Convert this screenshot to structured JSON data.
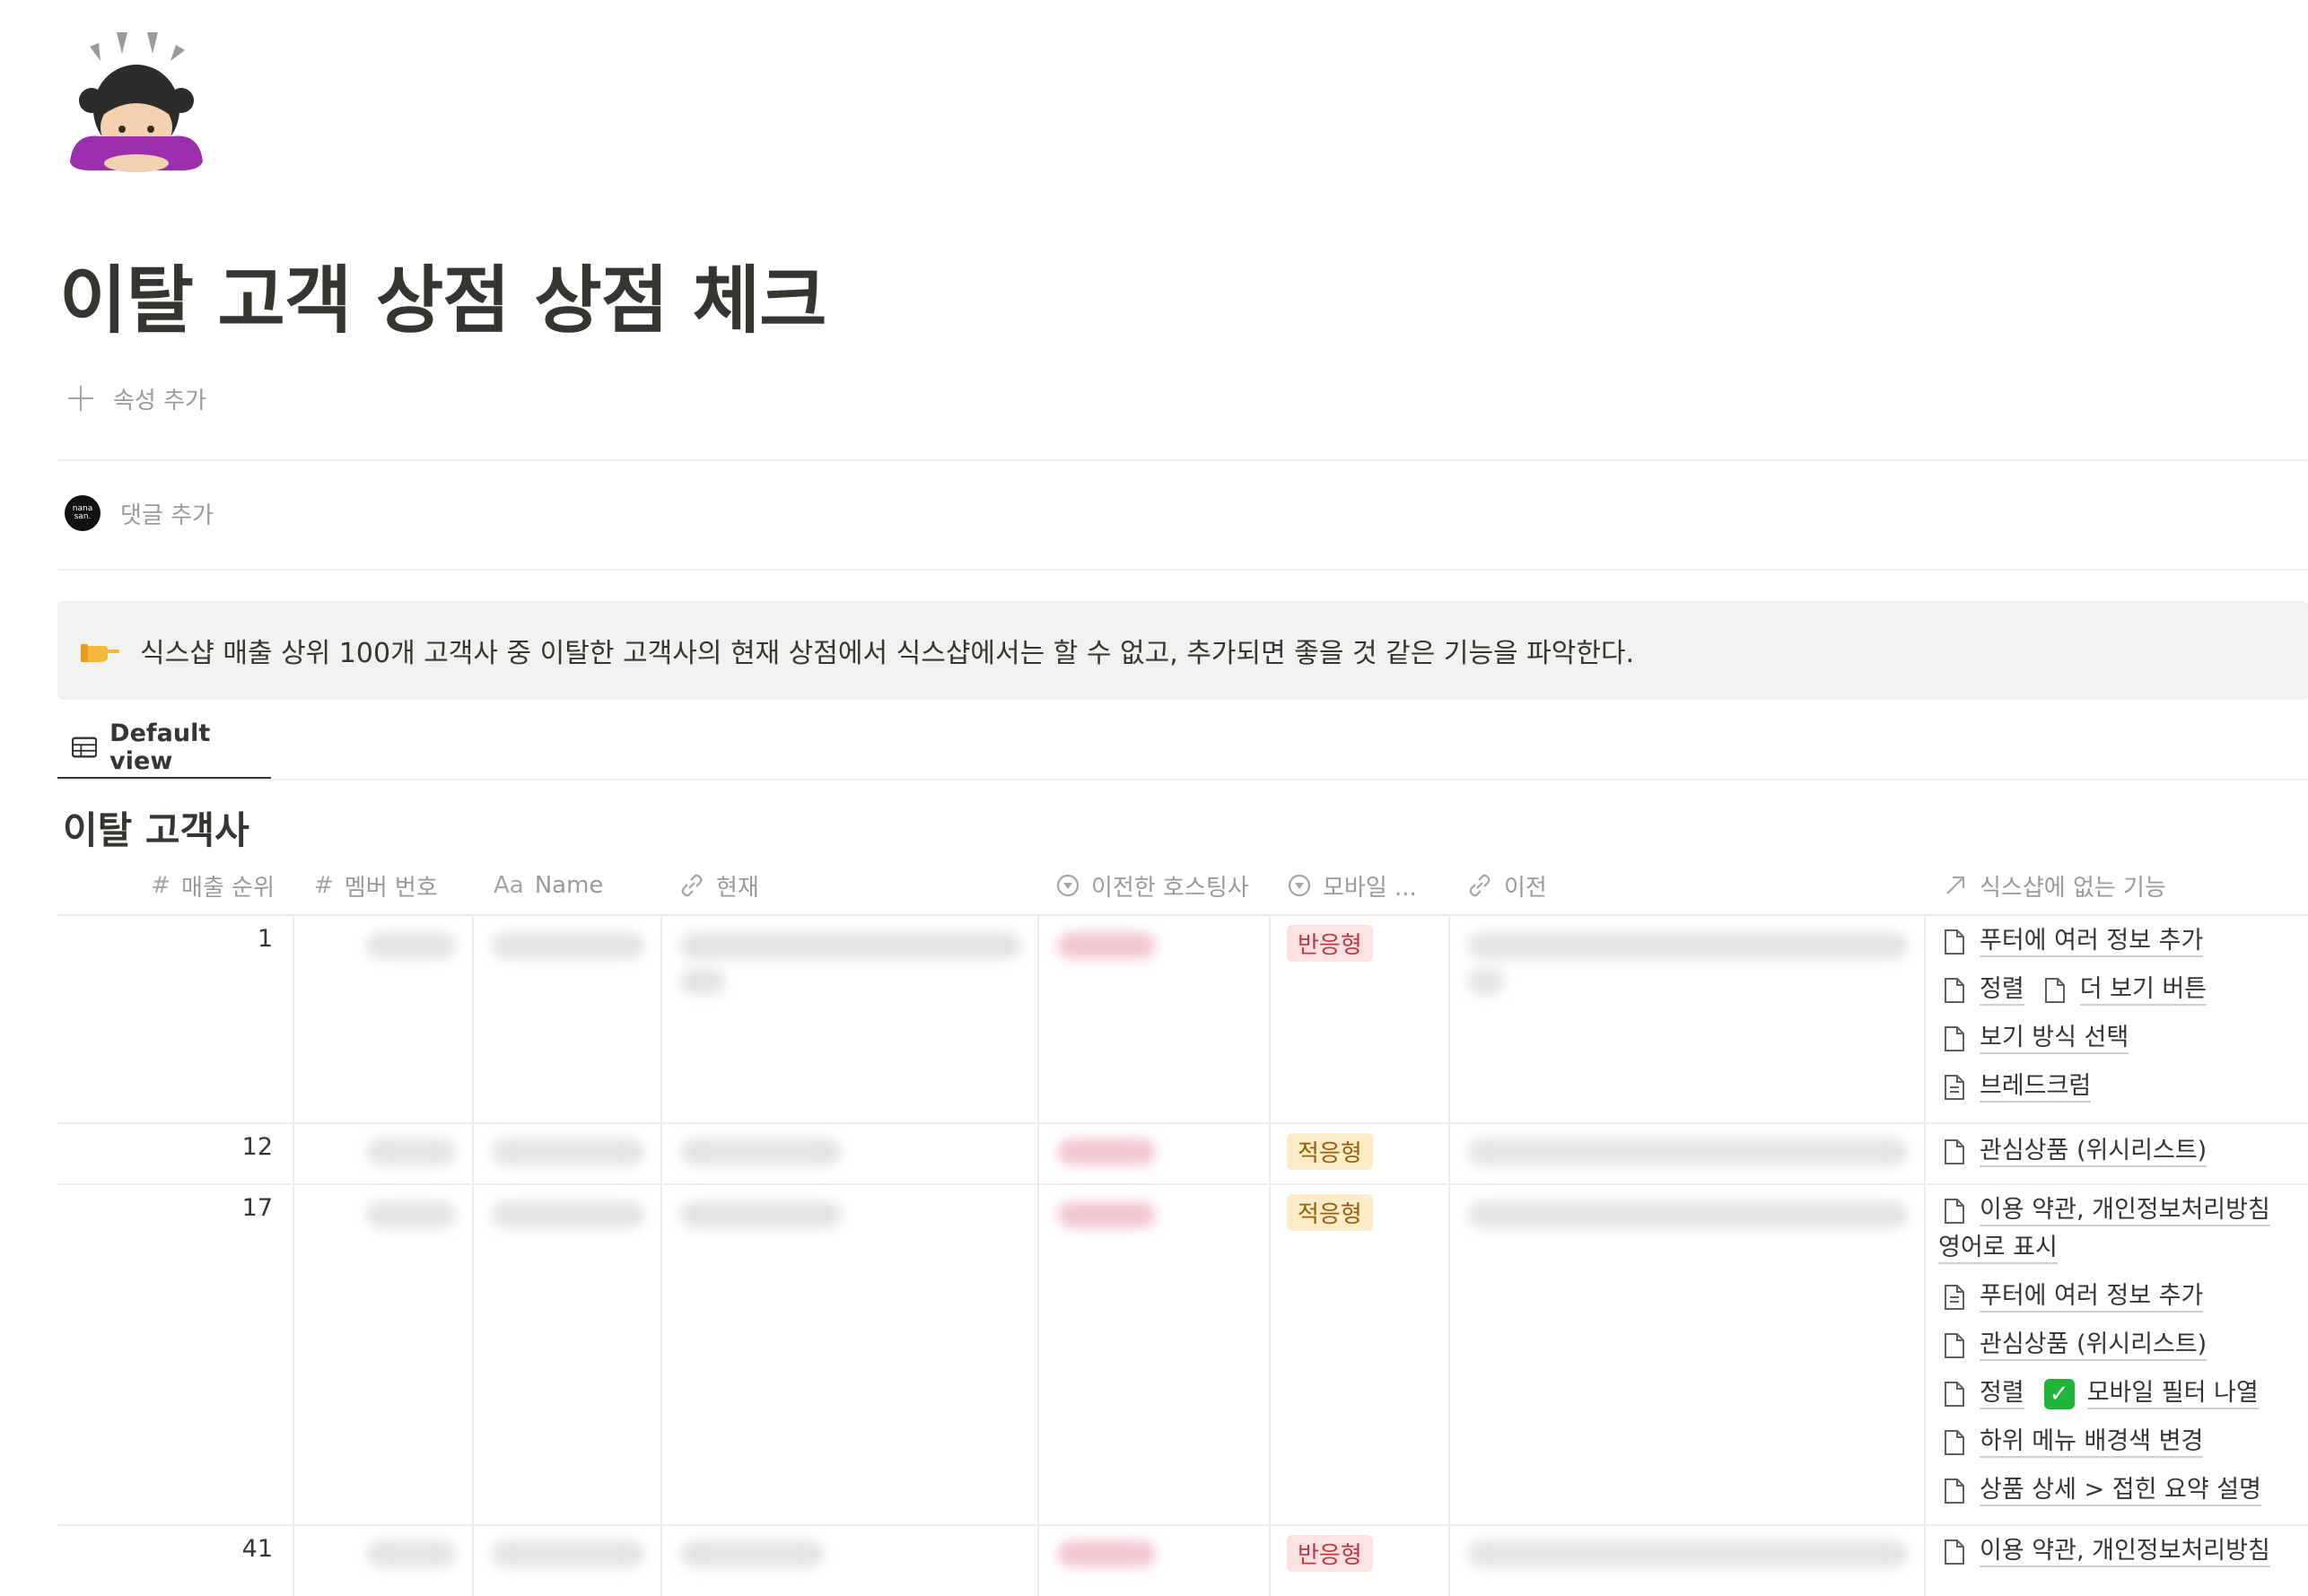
{
  "page": {
    "icon": "person-bowing-emoji",
    "title": "이탈 고객 상점 상점 체크",
    "add_property_label": "속성 추가",
    "avatar_text": "nana san.",
    "add_comment_label": "댓글 추가"
  },
  "callout": {
    "icon": "pointing-hand-emoji",
    "text": "식스샵 매출 상위 100개 고객사 중 이탈한 고객사의 현재 상점에서 식스샵에서는 할 수 없고, 추가되면 좋을 것 같은 기능을 파악한다."
  },
  "view": {
    "tab_label": "Default view",
    "tab_icon": "table-icon"
  },
  "database": {
    "title": "이탈 고객사",
    "columns": [
      {
        "icon": "#",
        "label": "매출 순위"
      },
      {
        "icon": "#",
        "label": "멤버 번호"
      },
      {
        "icon": "Aa",
        "label": "Name"
      },
      {
        "icon": "link-icon",
        "label": "현재"
      },
      {
        "icon": "select-icon",
        "label": "이전한 호스팅사"
      },
      {
        "icon": "select-icon",
        "label": "모바일 ..."
      },
      {
        "icon": "link-icon",
        "label": "이전"
      },
      {
        "icon": "relation-arrow-icon",
        "label": "식스샵에 없는 기능"
      }
    ],
    "rows": [
      {
        "rank": "1",
        "mobile": "반응형",
        "mobile_color": "#fde2e4",
        "features": [
          [
            "푸터에 여러 정보 추가"
          ],
          [
            "정렬",
            "더 보기 버튼"
          ],
          [
            "보기 방식 선택"
          ],
          [
            "브레드크럼"
          ]
        ]
      },
      {
        "rank": "12",
        "mobile": "적응형",
        "mobile_color": "#fdecc8",
        "features": [
          [
            "관심상품 (위시리스트)"
          ]
        ]
      },
      {
        "rank": "17",
        "mobile": "적응형",
        "mobile_color": "#fdecc8",
        "features": [
          [
            "이용 약관, 개인정보처리방침",
            "영어로 표시"
          ],
          [
            "푸터에 여러 정보 추가"
          ],
          [
            "관심상품 (위시리스트)"
          ],
          [
            "정렬",
            "모바일 필터 나열"
          ],
          [
            "하위 메뉴 배경색 변경"
          ],
          [
            "상품 상세 > 접힌 요약 설명"
          ]
        ]
      },
      {
        "rank": "41",
        "mobile": "반응형",
        "mobile_color": "#fde2e4",
        "features": [
          [
            "이용 약관, 개인정보처리방침"
          ]
        ]
      }
    ]
  }
}
